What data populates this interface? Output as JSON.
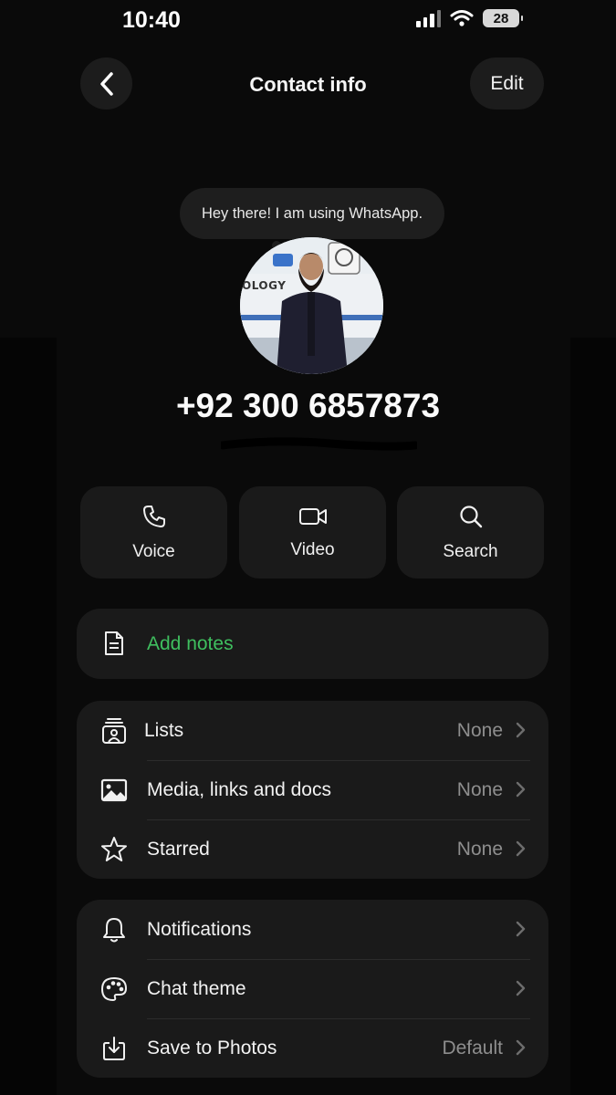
{
  "status_bar": {
    "time": "10:40",
    "battery": "28"
  },
  "header": {
    "title": "Contact info",
    "edit_label": "Edit"
  },
  "profile": {
    "about": "Hey there! I am using WhatsApp.",
    "phone": "+92 300 6857873",
    "avatar_banner_text": "OLOGY"
  },
  "actions": [
    {
      "label": "Voice",
      "icon": "phone-icon"
    },
    {
      "label": "Video",
      "icon": "video-camera-icon"
    },
    {
      "label": "Search",
      "icon": "search-icon"
    }
  ],
  "notes": {
    "label": "Add notes",
    "icon": "document-icon"
  },
  "media_group": [
    {
      "label": "Lists",
      "value": "None",
      "icon": "lists-icon"
    },
    {
      "label": "Media, links and docs",
      "value": "None",
      "icon": "image-icon"
    },
    {
      "label": "Starred",
      "value": "None",
      "icon": "star-icon"
    }
  ],
  "settings_group": [
    {
      "label": "Notifications",
      "value": "",
      "icon": "bell-icon"
    },
    {
      "label": "Chat theme",
      "value": "",
      "icon": "palette-icon"
    },
    {
      "label": "Save to Photos",
      "value": "Default",
      "icon": "download-icon"
    }
  ],
  "colors": {
    "accent_green": "#3fbf5f",
    "background": "#0a0a0a",
    "card": "#1a1a1a"
  }
}
